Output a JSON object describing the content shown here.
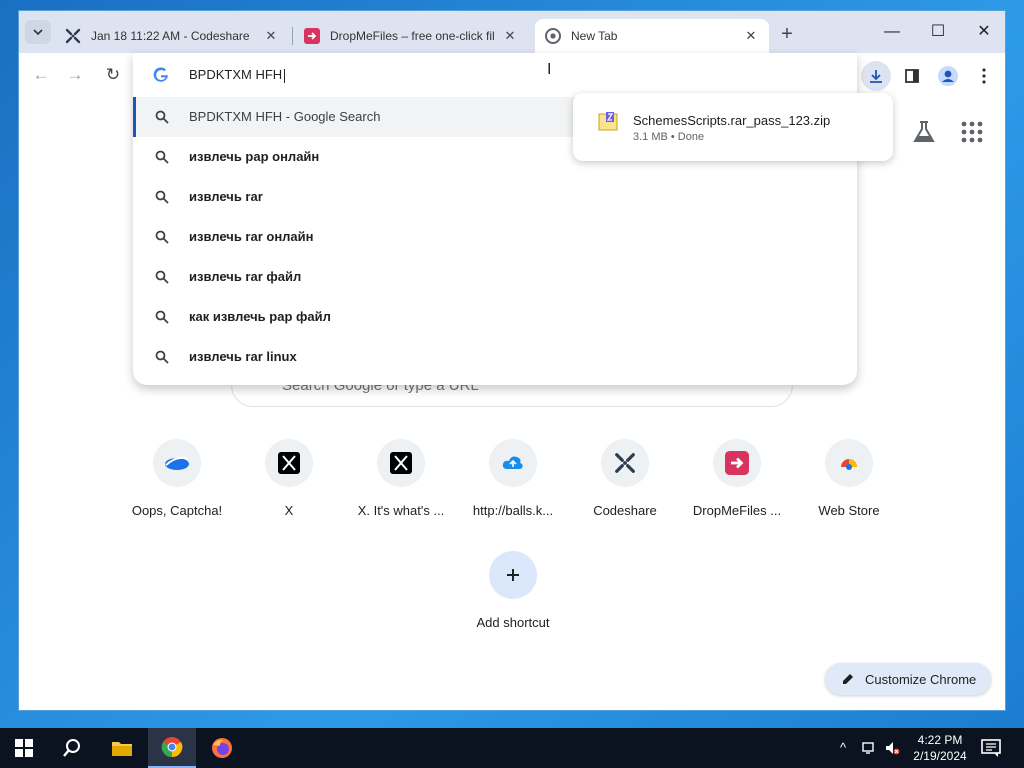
{
  "tabs": [
    {
      "title": "Jan 18 11:22 AM - Codeshare",
      "favicon": "codeshare-icon",
      "active": false
    },
    {
      "title": "DropMeFiles – free one-click fil",
      "favicon": "dropmefiles-icon",
      "active": false
    },
    {
      "title": "New Tab",
      "favicon": "chrome-icon",
      "active": true
    }
  ],
  "omnibox": {
    "value": "BPDKTXM HFH",
    "suggestions": [
      "BPDKTXM HFH - Google Search",
      "извлечь рар онлайн",
      "извлечь rar",
      "извлечь rar онлайн",
      "извлечь rar файл",
      "как извлечь рар файл",
      "извлечь rar linux"
    ]
  },
  "download": {
    "filename": "SchemesScripts.rar_pass_123.zip",
    "meta": "3.1 MB • Done"
  },
  "ntp": {
    "search_placeholder": "Search Google or type a URL",
    "shortcuts": [
      {
        "label": "Oops, Captcha!",
        "icon": "captcha-icon"
      },
      {
        "label": "X",
        "icon": "x-logo-icon"
      },
      {
        "label": "X. It's what's ...",
        "icon": "x-logo-icon"
      },
      {
        "label": "http://balls.k...",
        "icon": "cloud-upload-icon"
      },
      {
        "label": "Codeshare",
        "icon": "codeshare-icon"
      },
      {
        "label": "DropMeFiles ...",
        "icon": "dropmefiles-icon"
      },
      {
        "label": "Web Store",
        "icon": "webstore-icon"
      }
    ],
    "add_shortcut_label": "Add shortcut",
    "customize_label": "Customize Chrome"
  },
  "taskbar": {
    "time": "4:22 PM",
    "date": "2/19/2024"
  },
  "colors": {
    "accent": "#1a56b8",
    "tabstrip": "#dde3f0",
    "taskbar": "#0b1220",
    "desktop": "#1d87d6"
  }
}
